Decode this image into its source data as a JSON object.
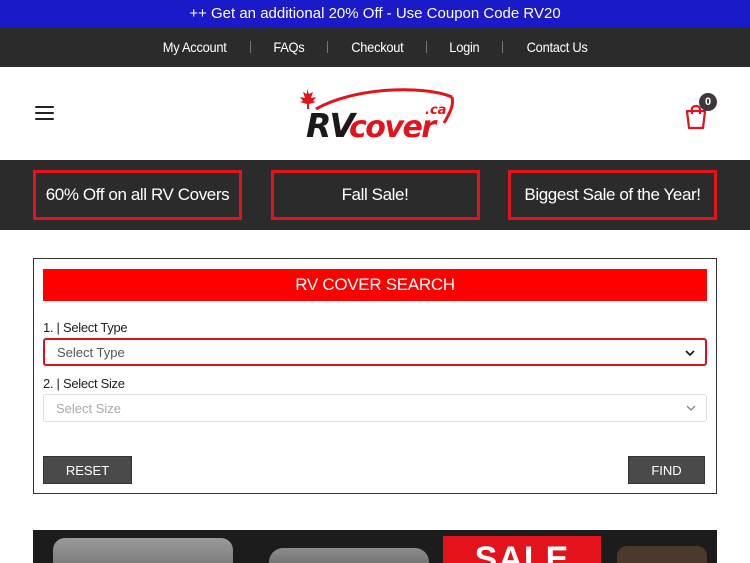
{
  "promo": {
    "text": "++ Get an additional 20% Off - Use Coupon Code RV20"
  },
  "topnav": {
    "items": [
      {
        "label": "My Account"
      },
      {
        "label": "FAQs"
      },
      {
        "label": "Checkout"
      },
      {
        "label": "Login"
      },
      {
        "label": "Contact Us"
      }
    ]
  },
  "header": {
    "logo_text": "RVcover",
    "logo_suffix": ".ca",
    "cart_count": "0",
    "icons": {
      "menu": "hamburger-menu-icon",
      "cart": "shopping-bag-icon",
      "logo_leaf": "maple-leaf-icon"
    }
  },
  "sale_band": {
    "buttons": [
      {
        "label": "60% Off on all RV Covers"
      },
      {
        "label": "Fall Sale!"
      },
      {
        "label": "Biggest Sale of the Year!"
      }
    ]
  },
  "search": {
    "title": "RV COVER SEARCH",
    "type_label": "1. | Select Type",
    "type_placeholder": "Select Type",
    "size_label": "2. | Select Size",
    "size_placeholder": "Select Size",
    "reset_label": "RESET",
    "find_label": "FIND"
  },
  "banner": {
    "sale_text": "SALE"
  },
  "colors": {
    "accent_red": "#ff0000",
    "dark_bar": "#2b2b2b",
    "promo_blue": "#1a1ac8"
  }
}
